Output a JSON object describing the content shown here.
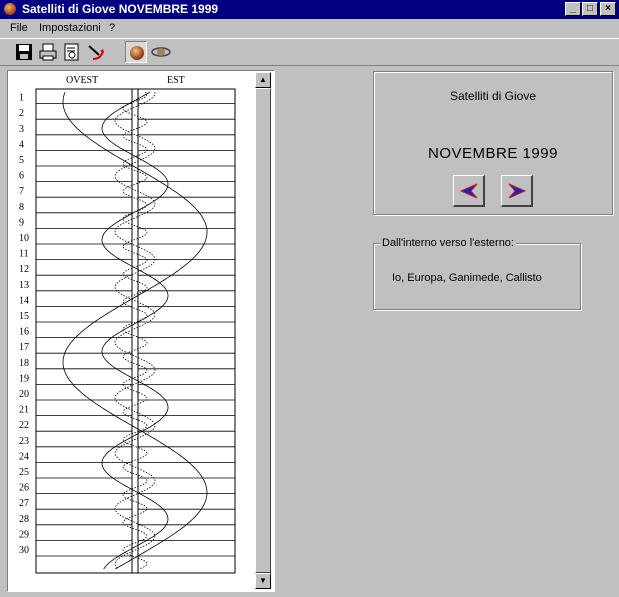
{
  "window": {
    "title": "Satelliti di Giove NOVEMBRE 1999",
    "controls": {
      "minimize": "_",
      "maximize": "□",
      "close": "×"
    }
  },
  "menu": [
    {
      "label": "File"
    },
    {
      "label": "Impostazioni"
    },
    {
      "label": "?"
    }
  ],
  "toolbar": {
    "buttons": [
      "save-icon",
      "print-icon",
      "print-preview-icon",
      "exit-icon",
      "jupiter-icon",
      "satellite-orbit-icon"
    ],
    "pressed": "jupiter-icon"
  },
  "chart": {
    "west_label": "OVEST",
    "east_label": "EST",
    "day_labels": [
      "1",
      "2",
      "3",
      "4",
      "5",
      "6",
      "7",
      "8",
      "9",
      "10",
      "11",
      "12",
      "13",
      "14",
      "15",
      "16",
      "17",
      "18",
      "19",
      "20",
      "21",
      "22",
      "23",
      "24",
      "25",
      "26",
      "27",
      "28",
      "29",
      "30"
    ]
  },
  "info": {
    "title": "Satelliti di Giove",
    "month": "NOVEMBRE 1999"
  },
  "legend": {
    "caption": "Dall'interno verso l'esterno:",
    "text": "Io, Europa, Ganimede, Callisto"
  },
  "colors": {
    "title_bar": "#000080",
    "nav_arrow": "#2020c0",
    "nav_arrow_edge": "#c02020"
  }
}
